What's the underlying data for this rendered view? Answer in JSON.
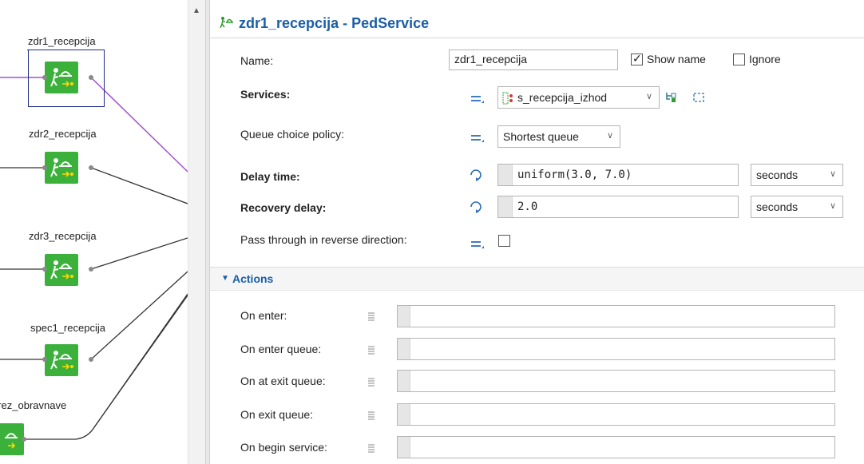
{
  "canvas": {
    "blocks": [
      {
        "label": "zdr1_recepcija"
      },
      {
        "label": "zdr2_recepcija"
      },
      {
        "label": "zdr3_recepcija"
      },
      {
        "label": "spec1_recepcija"
      },
      {
        "label": "prez_obravnave"
      }
    ]
  },
  "panel": {
    "title": "zdr1_recepcija - PedService",
    "title_icon": "ped-service-icon",
    "name_label": "Name:",
    "name_value": "zdr1_recepcija",
    "show_name_label": "Show name",
    "show_name_checked": true,
    "ignore_label": "Ignore",
    "ignore_checked": false,
    "services_label": "Services:",
    "services_value": "s_recepcija_izhod",
    "queue_policy_label": "Queue choice policy:",
    "queue_policy_value": "Shortest queue",
    "delay_time_label": "Delay time:",
    "delay_time_value": "uniform(3.0, 7.0)",
    "delay_time_unit": "seconds",
    "recovery_delay_label": "Recovery delay:",
    "recovery_delay_value": "2.0",
    "recovery_delay_unit": "seconds",
    "pass_through_label": "Pass through in reverse direction:",
    "pass_through_checked": false,
    "actions_header": "Actions",
    "actions": [
      {
        "label": "On enter:"
      },
      {
        "label": "On enter queue:"
      },
      {
        "label": "On at exit queue:"
      },
      {
        "label": "On exit queue:"
      },
      {
        "label": "On begin service:"
      }
    ]
  },
  "colors": {
    "accent": "#1a5ea8",
    "block_green": "#3bb03b",
    "selection": "#1f2a8a",
    "wire_purple": "#a24fd0"
  }
}
